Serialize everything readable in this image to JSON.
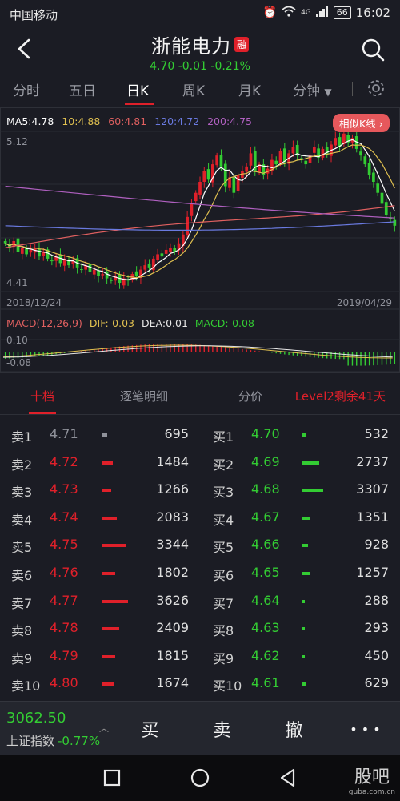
{
  "status_bar": {
    "carrier": "中国移动",
    "network": "4G",
    "battery": "66",
    "time": "16:02"
  },
  "header": {
    "stock_name": "浙能电力",
    "margin_badge": "融",
    "price": "4.70",
    "change": "-0.01",
    "change_pct": "-0.21%"
  },
  "tabs": [
    {
      "label": "分时"
    },
    {
      "label": "五日"
    },
    {
      "label": "日K"
    },
    {
      "label": "周K"
    },
    {
      "label": "月K"
    },
    {
      "label": "分钟"
    }
  ],
  "active_tab": "日K",
  "chart": {
    "similar_button": "相似K线",
    "ma": {
      "ma5": "MA5:4.78",
      "ma10": "10:4.88",
      "ma60": "60:4.81",
      "ma120": "120:4.72",
      "ma200": "200:4.75"
    },
    "price_high_label": "5.12",
    "price_low_label": "4.41",
    "date_start": "2018/12/24",
    "date_end": "2019/04/29",
    "macd": {
      "title": "MACD(12,26,9)",
      "dif": "DIF:-0.03",
      "dea": "DEA:0.01",
      "macd": "MACD:-0.08",
      "top_label": "0.10",
      "bottom_label": "-0.08"
    }
  },
  "chart_data": {
    "type": "candlestick",
    "x_range": [
      "2018/12/24",
      "2019/04/29"
    ],
    "ylim": [
      4.41,
      5.12
    ],
    "closes": [
      4.62,
      4.6,
      4.63,
      4.58,
      4.6,
      4.57,
      4.59,
      4.6,
      4.56,
      4.58,
      4.55,
      4.54,
      4.56,
      4.53,
      4.55,
      4.52,
      4.54,
      4.51,
      4.5,
      4.52,
      4.49,
      4.5,
      4.47,
      4.48,
      4.46,
      4.45,
      4.47,
      4.44,
      4.46,
      4.45,
      4.48,
      4.47,
      4.5,
      4.52,
      4.51,
      4.55,
      4.57,
      4.56,
      4.59,
      4.6,
      4.58,
      4.62,
      4.66,
      4.74,
      4.8,
      4.85,
      4.9,
      4.95,
      4.91,
      4.98,
      5.02,
      4.97,
      4.88,
      4.92,
      4.85,
      4.93,
      4.95,
      4.97,
      5.03,
      4.95,
      4.98,
      4.93,
      4.96,
      5.0,
      4.98,
      5.04,
      4.99,
      5.03,
      5.06,
      5.02,
      5.0,
      4.98,
      5.02,
      5.06,
      5.01,
      5.05,
      5.03,
      5.07,
      5.1,
      5.06,
      5.12,
      5.08,
      5.1,
      5.05,
      5.02,
      4.98,
      4.93,
      4.9,
      4.85,
      4.8,
      4.75,
      4.73,
      4.7
    ],
    "ma_colors": {
      "ma5": "#ffffff",
      "ma10": "#e0c050",
      "ma60": "#e06060",
      "ma120": "#6a7ae0",
      "ma200": "#b060c0"
    },
    "macd": {
      "dif": -0.03,
      "dea": 0.01,
      "macd": -0.08
    }
  },
  "book_tabs": {
    "ten": "十档",
    "detail": "逐笔明细",
    "price": "分价",
    "level2": "Level2剩余41天"
  },
  "order_book": {
    "sell": [
      {
        "label": "卖1",
        "price": "4.71",
        "volume": "695"
      },
      {
        "label": "卖2",
        "price": "4.72",
        "volume": "1484"
      },
      {
        "label": "卖3",
        "price": "4.73",
        "volume": "1266"
      },
      {
        "label": "卖4",
        "price": "4.74",
        "volume": "2083"
      },
      {
        "label": "卖5",
        "price": "4.75",
        "volume": "3344"
      },
      {
        "label": "卖6",
        "price": "4.76",
        "volume": "1802"
      },
      {
        "label": "卖7",
        "price": "4.77",
        "volume": "3626"
      },
      {
        "label": "卖8",
        "price": "4.78",
        "volume": "2409"
      },
      {
        "label": "卖9",
        "price": "4.79",
        "volume": "1815"
      },
      {
        "label": "卖10",
        "price": "4.80",
        "volume": "1674"
      }
    ],
    "buy": [
      {
        "label": "买1",
        "price": "4.70",
        "volume": "532"
      },
      {
        "label": "买2",
        "price": "4.69",
        "volume": "2737"
      },
      {
        "label": "买3",
        "price": "4.68",
        "volume": "3307"
      },
      {
        "label": "买4",
        "price": "4.67",
        "volume": "1351"
      },
      {
        "label": "买5",
        "price": "4.66",
        "volume": "928"
      },
      {
        "label": "买6",
        "price": "4.65",
        "volume": "1257"
      },
      {
        "label": "买7",
        "price": "4.64",
        "volume": "288"
      },
      {
        "label": "买8",
        "price": "4.63",
        "volume": "293"
      },
      {
        "label": "买9",
        "price": "4.62",
        "volume": "450"
      },
      {
        "label": "买10",
        "price": "4.61",
        "volume": "629"
      }
    ]
  },
  "bottom_bar": {
    "index_value": "3062.50",
    "index_name": "上证指数",
    "index_change": "-0.77%",
    "buy": "买",
    "sell": "卖",
    "cancel": "撤",
    "more": "• • •"
  },
  "watermark": {
    "main": "股吧",
    "sub": "guba.com.cn"
  },
  "colors": {
    "up": "#e0202a",
    "down": "#33cc33",
    "background": "#1b1c24"
  }
}
